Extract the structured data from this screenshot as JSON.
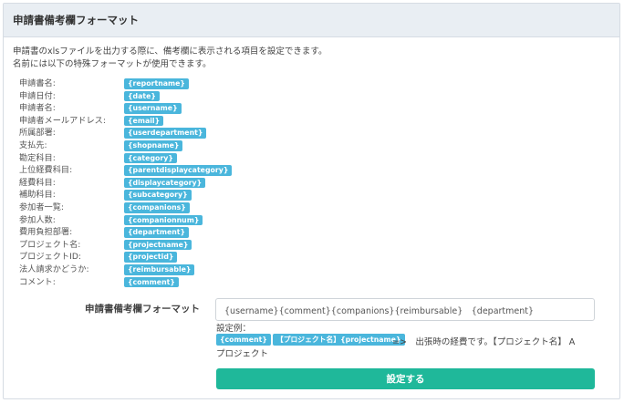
{
  "panel": {
    "title": "申請書備考欄フォーマット"
  },
  "description": {
    "line1": "申請書のxlsファイルを出力する際に、備考欄に表示される項目を設定できます。",
    "line2": "名前には以下の特殊フォーマットが使用できます。"
  },
  "fields": [
    {
      "label": "申請書名:",
      "tag": "{reportname}"
    },
    {
      "label": "申請日付:",
      "tag": "{date}"
    },
    {
      "label": "申請者名:",
      "tag": "{username}"
    },
    {
      "label": "申請者メールアドレス:",
      "tag": "{email}"
    },
    {
      "label": "所属部署:",
      "tag": "{userdepartment}"
    },
    {
      "label": "支払先:",
      "tag": "{shopname}"
    },
    {
      "label": "勘定科目:",
      "tag": "{category}"
    },
    {
      "label": "上位経費科目:",
      "tag": "{parentdisplaycategory}"
    },
    {
      "label": "経費科目:",
      "tag": "{displaycategory}"
    },
    {
      "label": "補助科目:",
      "tag": "{subcategory}"
    },
    {
      "label": "参加者一覧:",
      "tag": "{companions}"
    },
    {
      "label": "参加人数:",
      "tag": "{companionnum}"
    },
    {
      "label": "費用負担部署:",
      "tag": "{department}"
    },
    {
      "label": "プロジェクト名:",
      "tag": "{projectname}"
    },
    {
      "label": "プロジェクトID:",
      "tag": "{projectid}"
    },
    {
      "label": "法人請求かどうか:",
      "tag": "{reimbursable}"
    },
    {
      "label": "コメント:",
      "tag": "{comment}"
    }
  ],
  "form": {
    "label": "申請書備考欄フォーマット",
    "input_value": "{username}{comment}{companions}{reimbursable}　{department}",
    "example_label": "設定例：",
    "example_tags": [
      "{comment}",
      "【プロジェクト名】{projectname}"
    ],
    "example_result": "=>　出張時の経費です。【プロジェクト名】 A",
    "example_result_wrap": "プロジェクト",
    "submit_label": "設定する"
  },
  "colors": {
    "tag": "#4ab6dc",
    "submit": "#1fb89a",
    "header_bg": "#e9eef3"
  }
}
